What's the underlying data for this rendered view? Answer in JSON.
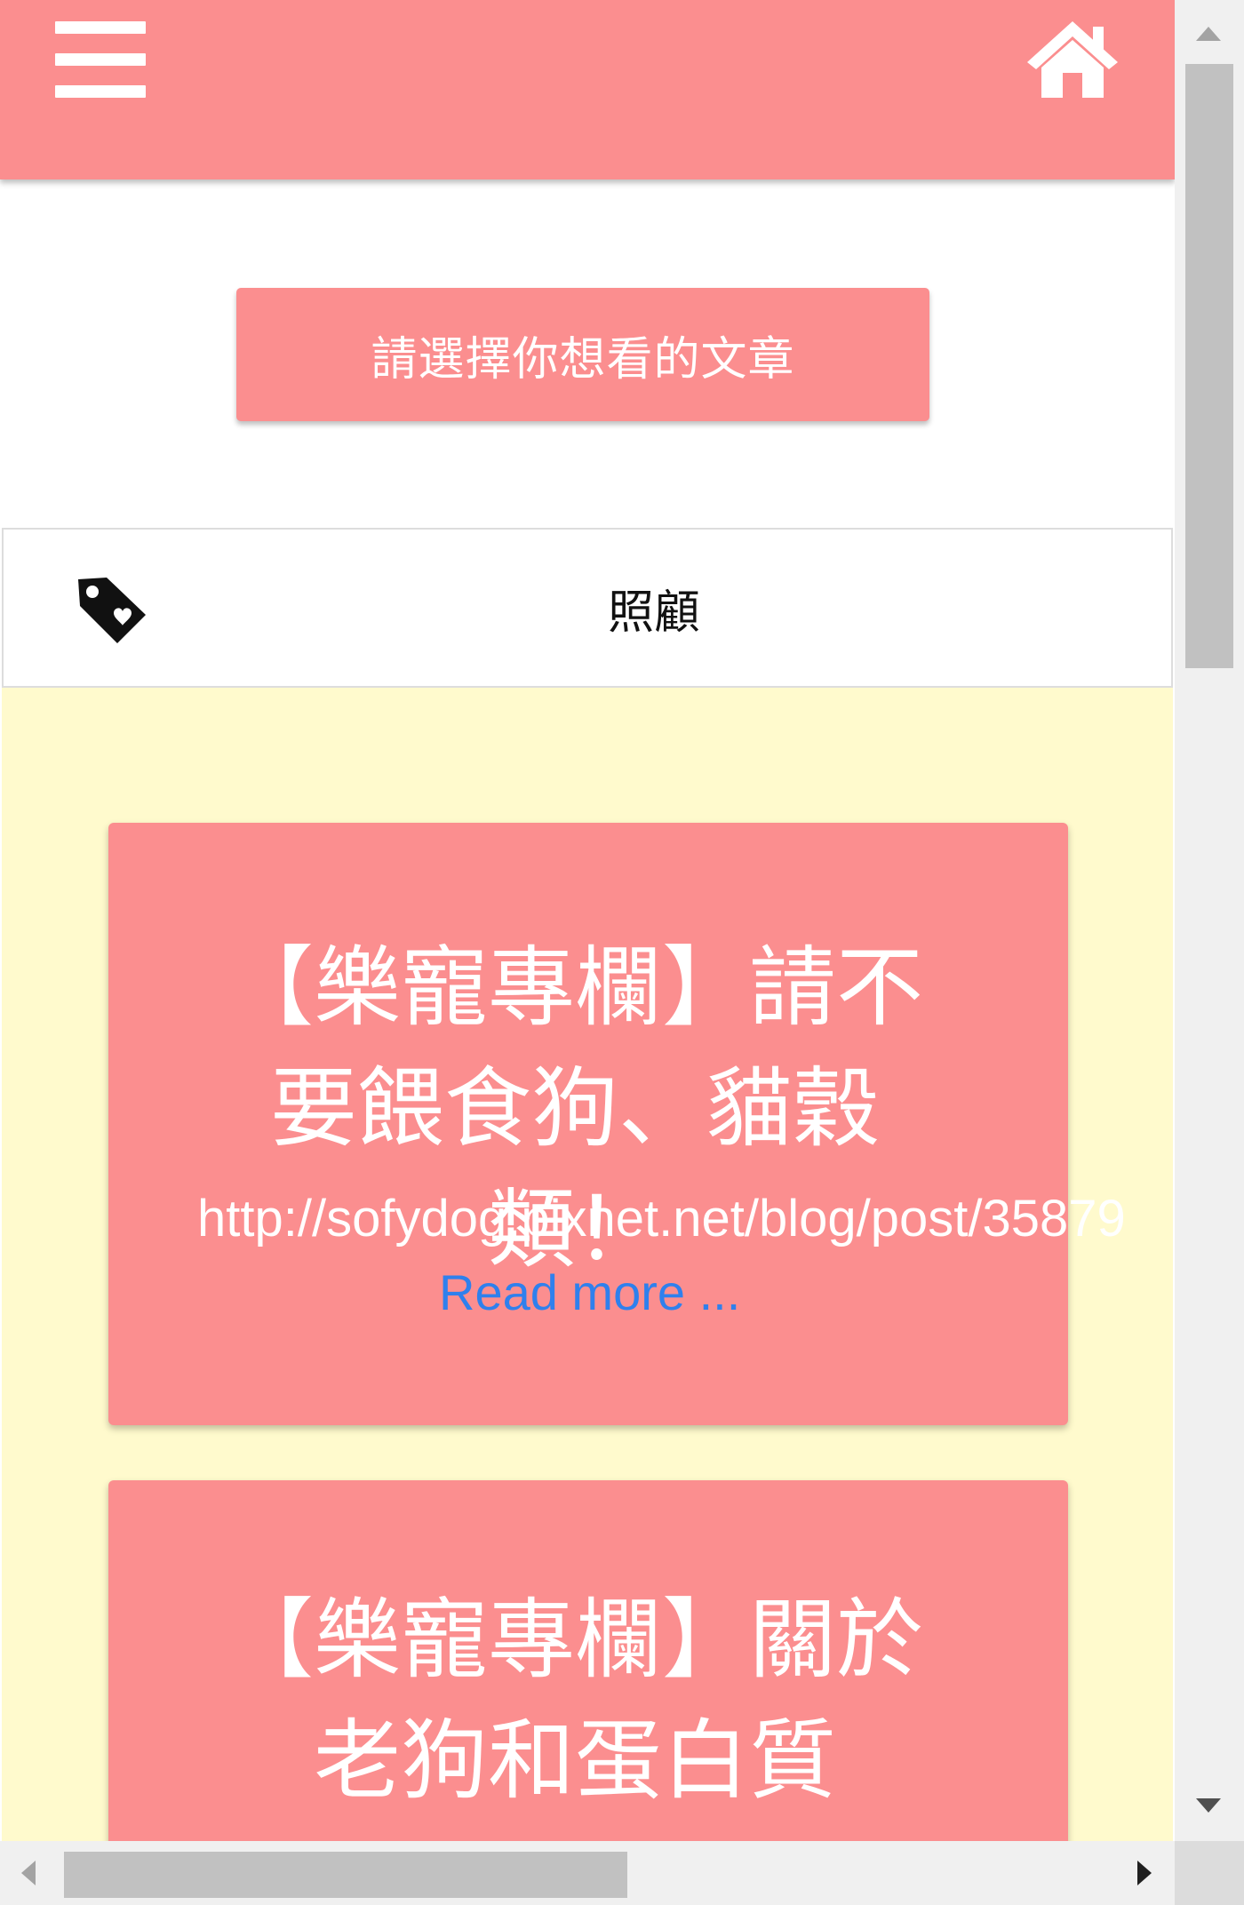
{
  "header": {
    "menu_icon": "hamburger-menu-icon",
    "home_icon": "home-icon",
    "background_color": "#fb8e8f"
  },
  "selector": {
    "button_label": "請選擇你想看的文章"
  },
  "category": {
    "icon": "tag-icon",
    "label": "照顧"
  },
  "articles": [
    {
      "title": "【樂寵專欄】請不要餵食狗、貓穀類！",
      "link": "http://sofydog.pixnet.net/blog/post/35879",
      "read_more": "Read more ..."
    },
    {
      "title": "【樂寵專欄】關於老狗和蛋白質"
    }
  ],
  "colors": {
    "accent": "#fb8e8f",
    "content_background": "#fffacd",
    "link": "#2f80ed"
  }
}
